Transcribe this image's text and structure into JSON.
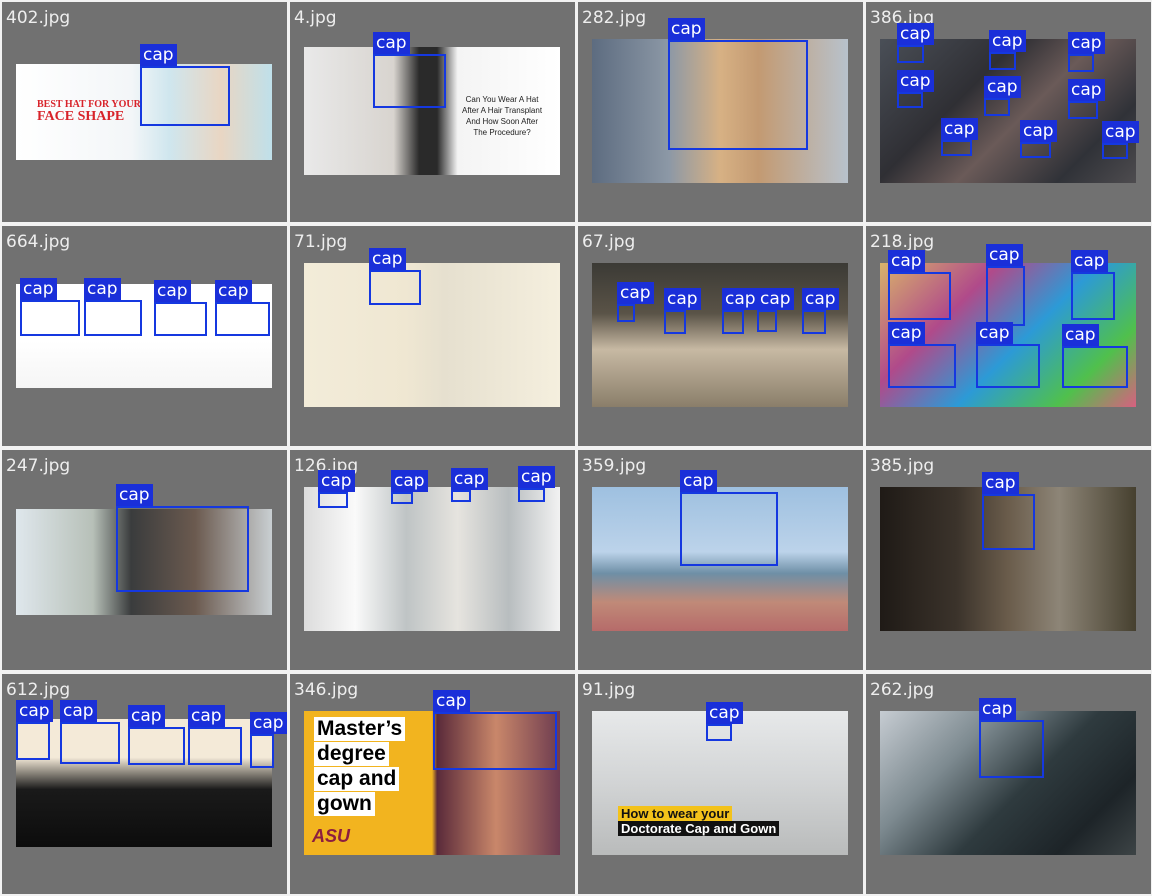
{
  "grid": {
    "label_text": "cap",
    "cells": [
      {
        "file": "402.jpg",
        "caption_lines": [
          "BEST HAT FOR YOUR",
          "FACE SHAPE"
        ],
        "detections": 1
      },
      {
        "file": "4.jpg",
        "caption_lines": [
          "Can You Wear A Hat",
          "After A Hair Transplant",
          "And How Soon After",
          "The Procedure?"
        ],
        "detections": 1
      },
      {
        "file": "282.jpg",
        "caption_lines": [],
        "detections": 1
      },
      {
        "file": "386.jpg",
        "caption_lines": [],
        "detections": 9
      },
      {
        "file": "664.jpg",
        "caption_lines": [],
        "detections": 4
      },
      {
        "file": "71.jpg",
        "caption_lines": [],
        "detections": 1
      },
      {
        "file": "67.jpg",
        "caption_lines": [],
        "detections": 5
      },
      {
        "file": "218.jpg",
        "caption_lines": [],
        "detections": 6
      },
      {
        "file": "247.jpg",
        "caption_lines": [],
        "detections": 1
      },
      {
        "file": "126.jpg",
        "caption_lines": [],
        "detections": 4
      },
      {
        "file": "359.jpg",
        "caption_lines": [],
        "detections": 1
      },
      {
        "file": "385.jpg",
        "caption_lines": [],
        "detections": 1
      },
      {
        "file": "612.jpg",
        "caption_lines": [],
        "detections": 5
      },
      {
        "file": "346.jpg",
        "caption_lines": [
          "Master’s",
          "degree",
          "cap and",
          "gown"
        ],
        "logo": "ASU",
        "detections": 1
      },
      {
        "file": "91.jpg",
        "caption_lines": [
          "How to wear your",
          "Doctorate Cap and Gown"
        ],
        "detections": 1
      },
      {
        "file": "262.jpg",
        "caption_lines": [],
        "detections": 1
      }
    ]
  },
  "colors": {
    "cell_bg": "#717171",
    "box": "#1538e0",
    "label_bg": "#1a2fd9",
    "label_text": "#ffffff",
    "filename_text": "#eeeeee"
  }
}
